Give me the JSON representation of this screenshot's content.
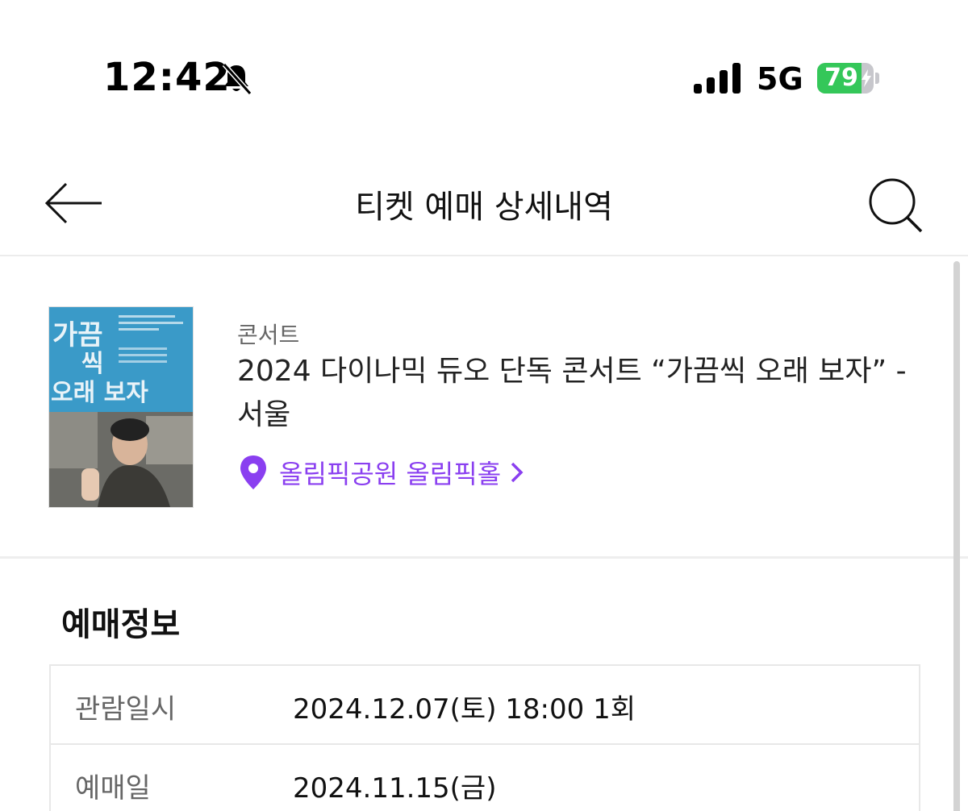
{
  "status_bar": {
    "time": "12:42",
    "network": "5G",
    "battery_percent": "79",
    "battery_level": 0.79,
    "icons": [
      "bell-slash-icon",
      "signal-icon",
      "battery-icon",
      "charging-bolt-icon"
    ]
  },
  "nav": {
    "title": "티켓 예매 상세내역",
    "back_icon": "arrow-left-icon",
    "search_icon": "search-icon"
  },
  "event": {
    "category": "콘서트",
    "title": "2024 다이나믹 듀오 단독 콘서트 “가끔씩 오래 보자” - 서울",
    "venue": "올림픽공원 올림픽홀",
    "venue_icon": "map-pin-icon",
    "poster": {
      "headline_1": "가끔",
      "headline_2": "씩",
      "headline_3": "오래 보자"
    }
  },
  "booking": {
    "section_title": "예매정보",
    "rows": [
      {
        "label": "관람일시",
        "value": "2024.12.07(토) 18:00 1회"
      },
      {
        "label": "예매일",
        "value": "2024.11.15(금)"
      }
    ]
  },
  "colors": {
    "accent": "#8a3ff0",
    "battery_green": "#34c759",
    "poster_blue": "#3a9ac8"
  }
}
